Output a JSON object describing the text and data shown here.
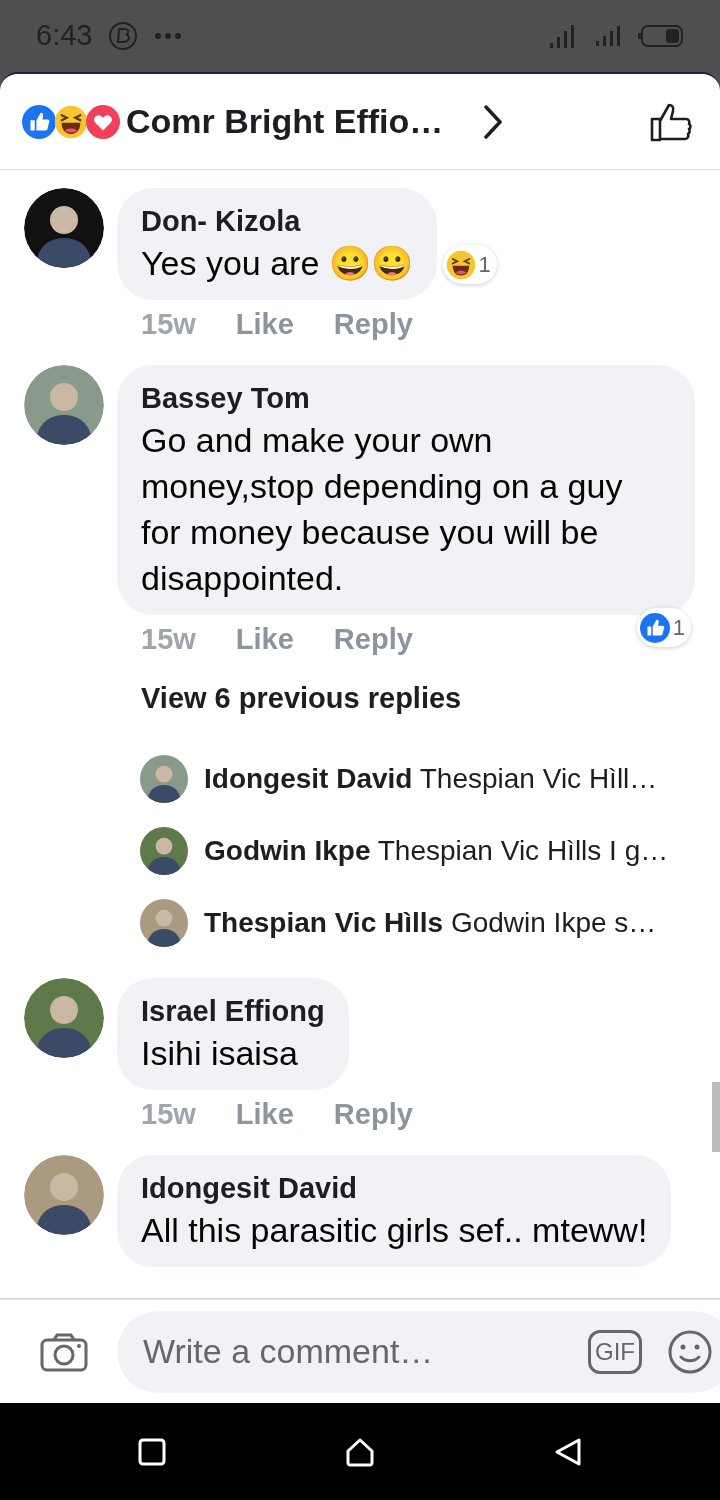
{
  "status_bar": {
    "time": "6:43"
  },
  "header": {
    "title": "Comr Bright Effio…"
  },
  "comments": [
    {
      "author": "Don- Kizola",
      "text": "Yes you are 😀😀",
      "reaction": {
        "kind": "haha",
        "count": "1"
      },
      "time": "15w",
      "like": "Like",
      "reply": "Reply"
    },
    {
      "author": "Bassey Tom",
      "text": "Go and make your own money,stop depending on a guy for money because you will be disappointed.",
      "reaction": {
        "kind": "like",
        "count": "1"
      },
      "time": "15w",
      "like": "Like",
      "reply": "Reply",
      "view_replies": "View 6 previous replies",
      "replies": [
        {
          "author": "Idongesit David",
          "text": "Thespian Vic Hìll…"
        },
        {
          "author": "Godwin Ikpe",
          "text": "Thespian Vic Hìlls I g…"
        },
        {
          "author": "Thespian Vic Hìlls",
          "text": "Godwin Ikpe s…"
        }
      ]
    },
    {
      "author": "Israel Effiong",
      "text": "Isihi isaisa",
      "time": "15w",
      "like": "Like",
      "reply": "Reply"
    },
    {
      "author": "Idongesit David",
      "text": "All this parasitic girls sef.. mteww!"
    }
  ],
  "composer": {
    "placeholder": "Write a comment…",
    "gif": "GIF"
  }
}
